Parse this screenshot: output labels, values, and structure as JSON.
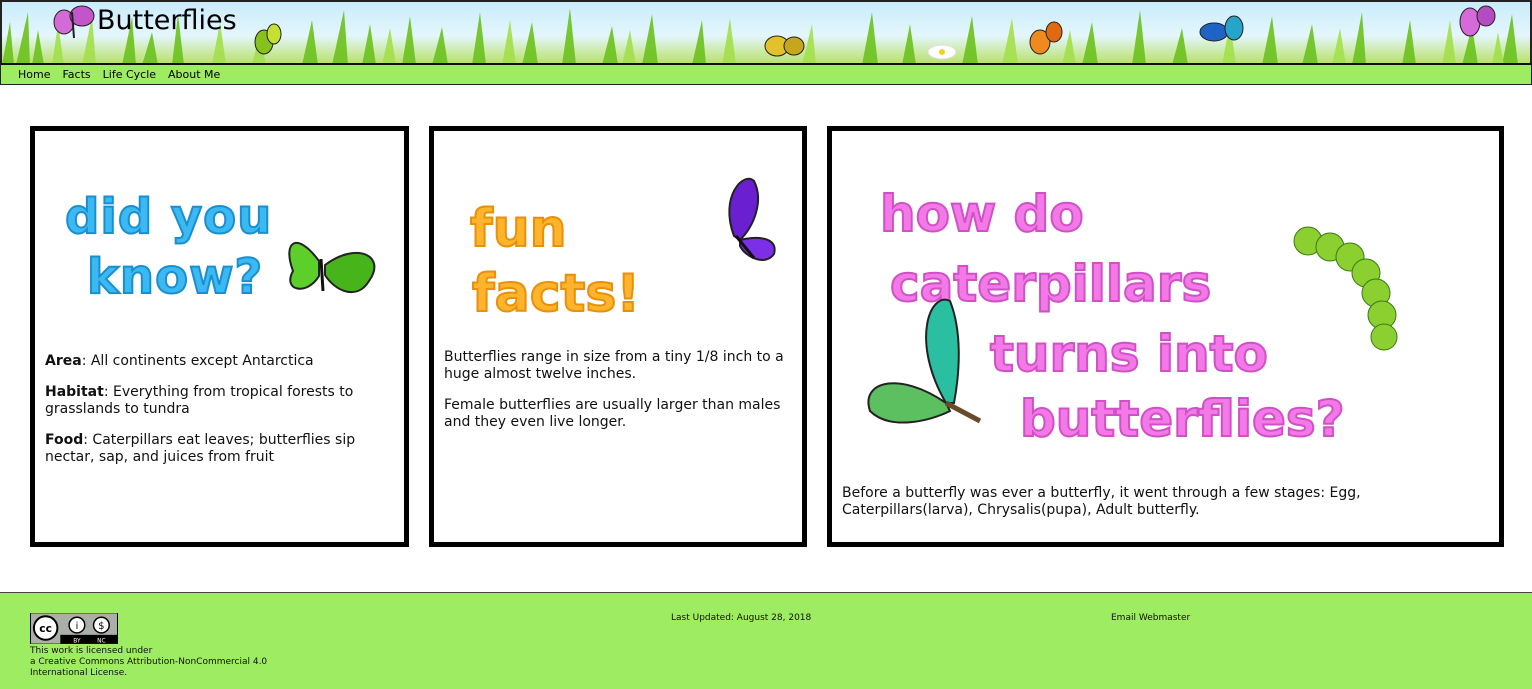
{
  "header": {
    "title": "Butterflies"
  },
  "nav": {
    "items": [
      "Home",
      "Facts",
      "Life Cycle",
      "About Me"
    ]
  },
  "cards": {
    "did_you_know": {
      "heading_art": "did you know?",
      "area_label": "Area",
      "area_text": ": All continents except Antarctica",
      "habitat_label": "Habitat",
      "habitat_text": ": Everything from tropical forests to grasslands to tundra",
      "food_label": "Food",
      "food_text": ": Caterpillars eat leaves; butterflies sip nectar, sap, and juices from fruit"
    },
    "fun_facts": {
      "heading_art": "fun facts!",
      "p1": "Butterflies range in size from a tiny 1/8 inch to a huge almost twelve inches.",
      "p2": "Female butterflies are usually larger than males and they even live longer."
    },
    "how_do": {
      "heading_art": "how do caterpillars turns into butterflies?",
      "p1": "Before a butterfly was ever a butterfly, it went through a few stages: Egg, Caterpillars(larva), Chrysalis(pupa), Adult butterfly."
    }
  },
  "footer": {
    "license_line1": "This work is licensed under",
    "license_link": "a Creative Commons Attribution-NonCommercial 4.0 International License.",
    "updated": "Last Updated: August 28, 2018",
    "email": "Email Webmaster"
  },
  "colors": {
    "nav_green": "#9eec62",
    "blue_art": "#3bb9f2",
    "orange_art": "#ffb42b",
    "pink_art": "#f37ae6"
  }
}
